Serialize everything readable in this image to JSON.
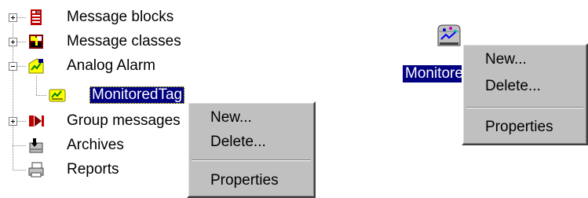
{
  "tree": {
    "items": [
      {
        "label": "Message blocks",
        "expander": "+",
        "icon": "message-blocks-icon"
      },
      {
        "label": "Message classes",
        "expander": "+",
        "icon": "message-classes-icon"
      },
      {
        "label": "Analog Alarm",
        "expander": "-",
        "icon": "analog-alarm-icon"
      },
      {
        "label": "MonitoredTag",
        "expander": "",
        "icon": "monitored-tag-icon",
        "selected": true
      },
      {
        "label": "Group messages",
        "expander": "+",
        "icon": "group-messages-icon"
      },
      {
        "label": "Archives",
        "expander": "",
        "icon": "archives-icon"
      },
      {
        "label": "Reports",
        "expander": "",
        "icon": "reports-icon"
      }
    ]
  },
  "context_menu_left": {
    "items": [
      "New...",
      "Delete...",
      "Properties"
    ]
  },
  "context_menu_right": {
    "items": [
      "New...",
      "Delete...",
      "Properties"
    ]
  },
  "right_pane": {
    "item_label": "MonitoredTag",
    "item_icon": "monitored-tag-large-icon"
  },
  "colors": {
    "selection_bg": "#000080",
    "menu_bg": "#c0c0c0"
  }
}
